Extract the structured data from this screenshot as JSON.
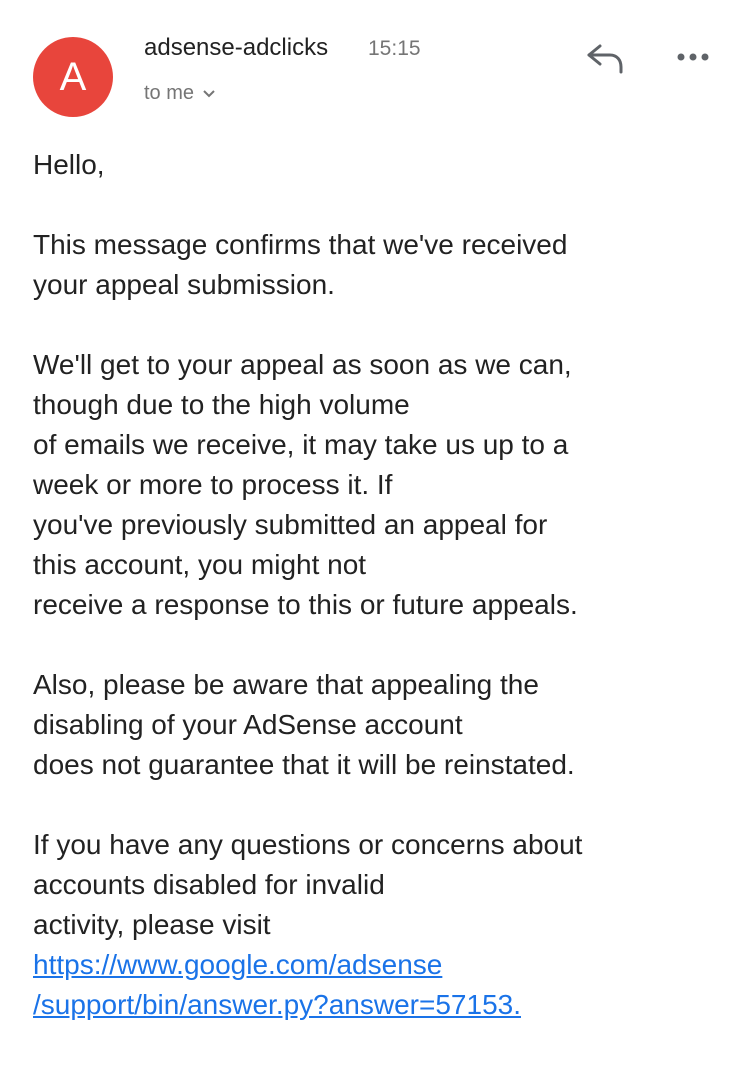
{
  "header": {
    "avatar_letter": "A",
    "sender": "adsense-adclicks",
    "time": "15:15",
    "recipient": "to me",
    "reply_icon": "reply-icon",
    "more_icon": "more-horizontal-icon",
    "avatar_color": "#e8453c"
  },
  "body": {
    "greeting": "Hello,",
    "p1": [
      "This message confirms that we've received",
      "your appeal submission."
    ],
    "p2": [
      "We'll get to your appeal as soon as we can,",
      "though due to the high volume",
      "of emails we receive, it may take us up to a",
      "week or more to process it. If",
      "you've previously submitted an appeal for",
      "this account, you might not",
      "receive a response to this or future appeals."
    ],
    "p3": [
      "Also, please be aware that appealing the",
      "disabling of your AdSense account",
      "does not guarantee that it will be reinstated."
    ],
    "p4": [
      "If you have any questions or concerns about",
      "accounts disabled for invalid",
      "activity, please visit"
    ],
    "link": [
      "https://www.google.com/adsense",
      "/support/bin/answer.py?answer=57153."
    ],
    "link_color": "#1a73e8"
  }
}
